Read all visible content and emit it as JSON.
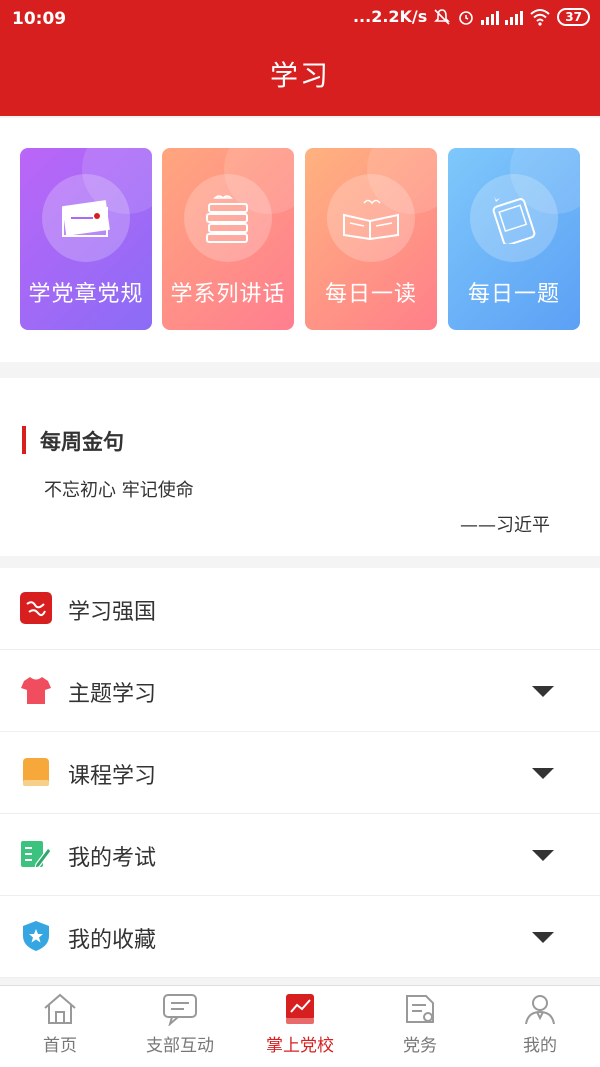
{
  "status": {
    "time": "10:09",
    "speed": "...2.2K/s",
    "battery": "37"
  },
  "header": {
    "title": "学习"
  },
  "cards": [
    {
      "label": "学党章党规",
      "icon": "book-stack-icon"
    },
    {
      "label": "学系列讲话",
      "icon": "books-icon"
    },
    {
      "label": "每日一读",
      "icon": "open-book-icon"
    },
    {
      "label": "每日一题",
      "icon": "phone-icon"
    }
  ],
  "quote": {
    "title": "每周金句",
    "text": "不忘初心 牢记使命",
    "author": "——习近平"
  },
  "menu": [
    {
      "label": "学习强国",
      "icon": "xuexi-logo-icon",
      "expand": false
    },
    {
      "label": "主题学习",
      "icon": "shirt-icon",
      "expand": true
    },
    {
      "label": "课程学习",
      "icon": "book-icon",
      "expand": true
    },
    {
      "label": "我的考试",
      "icon": "exam-icon",
      "expand": true
    },
    {
      "label": "我的收藏",
      "icon": "shield-star-icon",
      "expand": true
    }
  ],
  "tabs": [
    {
      "label": "首页",
      "icon": "home-icon",
      "active": false
    },
    {
      "label": "支部互动",
      "icon": "chat-icon",
      "active": false
    },
    {
      "label": "掌上党校",
      "icon": "chart-book-icon",
      "active": true
    },
    {
      "label": "党务",
      "icon": "document-icon",
      "active": false
    },
    {
      "label": "我的",
      "icon": "user-icon",
      "active": false
    }
  ],
  "colors": {
    "brand": "#d71f20",
    "card1": "#a86af7",
    "card2": "#ff8e88",
    "card3": "#ff9585",
    "card4": "#6db4f8"
  }
}
